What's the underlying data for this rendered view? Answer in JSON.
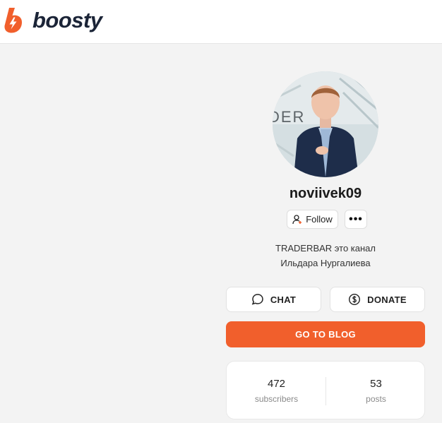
{
  "header": {
    "brand": "boosty",
    "brand_color": "#f15f2c"
  },
  "profile": {
    "username": "noviivek09",
    "avatar_icon": "user-avatar-photo",
    "follow_label": "Follow",
    "more_label": "•••",
    "description_line1": "TRADERBAR это канал",
    "description_line2": "Ильдара Нургалиева"
  },
  "actions": {
    "chat_label": "CHAT",
    "donate_label": "DONATE",
    "go_to_blog_label": "GO TO BLOG"
  },
  "stats": {
    "subscribers_count": "472",
    "subscribers_label": "subscribers",
    "posts_count": "53",
    "posts_label": "posts"
  },
  "colors": {
    "accent": "#f15f2c",
    "background": "#f3f3f3"
  }
}
